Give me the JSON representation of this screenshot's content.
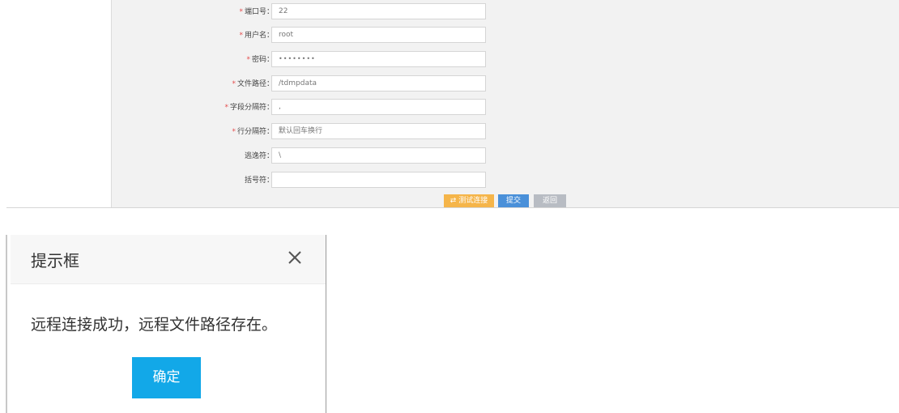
{
  "form": {
    "fields": [
      {
        "label": "端口号：",
        "required": true,
        "value": "22"
      },
      {
        "label": "用户名：",
        "required": true,
        "value": "root"
      },
      {
        "label": "密码：",
        "required": true,
        "value": "••••••••"
      },
      {
        "label": "文件路径：",
        "required": true,
        "value": "/tdmpdata"
      },
      {
        "label": "字段分隔符：",
        "required": true,
        "value": ","
      },
      {
        "label": "行分隔符：",
        "required": true,
        "value": "默认回车换行"
      },
      {
        "label": "逃逸符：",
        "required": false,
        "value": "\\"
      },
      {
        "label": "括号符：",
        "required": false,
        "value": ""
      }
    ],
    "required_mark": "*",
    "buttons": {
      "test_connection": "⇄ 测试连接",
      "submit": "提交",
      "back": "返回"
    }
  },
  "dialog": {
    "title": "提示框",
    "message": "远程连接成功，远程文件路径存在。",
    "ok_label": "确定",
    "close_icon": "close-icon"
  },
  "colors": {
    "panel_bg": "#f2f2f2",
    "required": "#e54e4e",
    "test_button": "#f5b54a",
    "submit_button": "#4a90d9",
    "back_button": "#b8bcc3",
    "dialog_ok": "#12a8e8"
  }
}
